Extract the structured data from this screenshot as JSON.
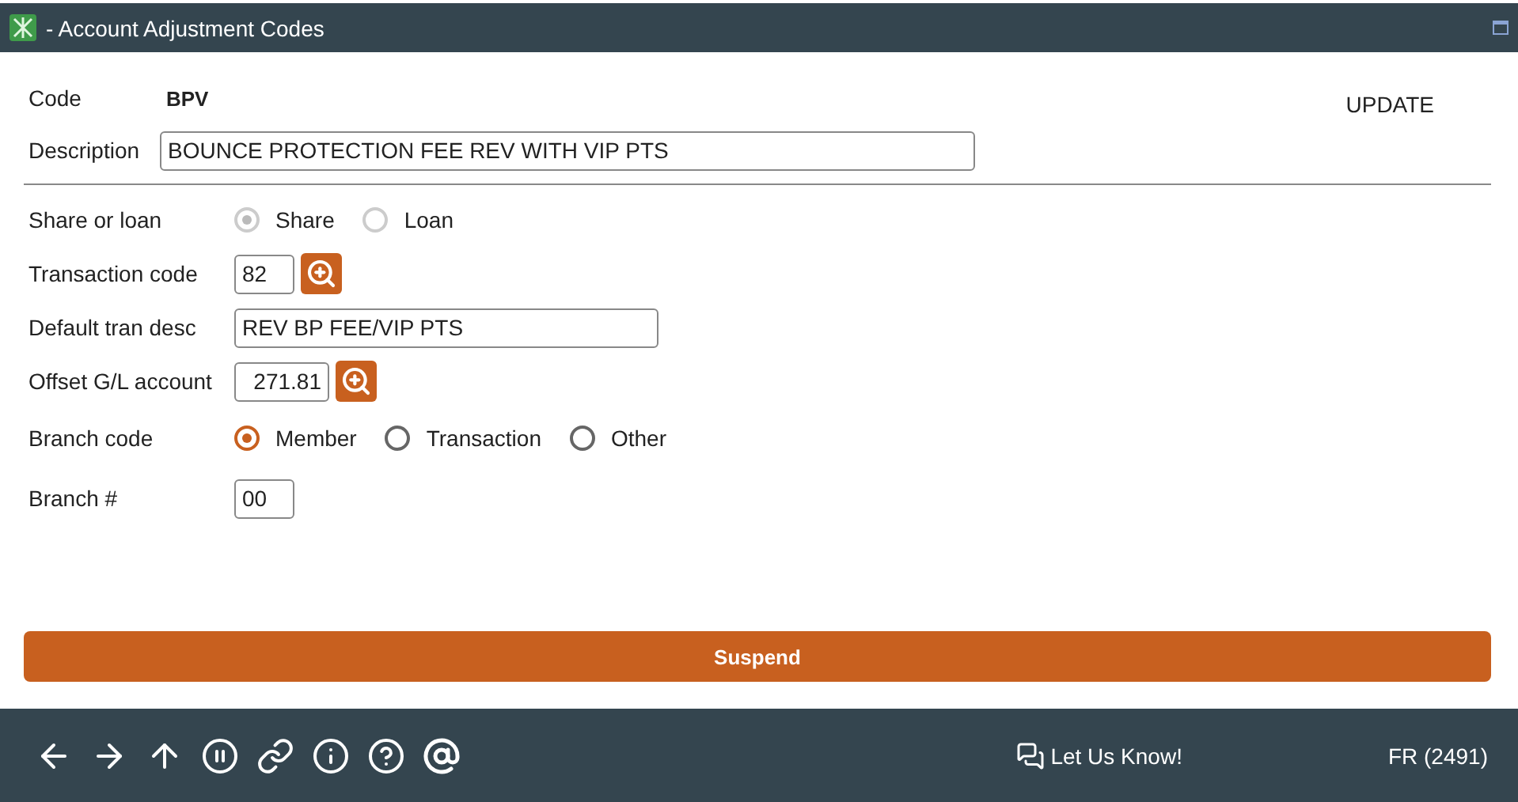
{
  "window": {
    "title": "- Account Adjustment Codes"
  },
  "header": {
    "code_label": "Code",
    "code_value": "BPV",
    "mode": "UPDATE",
    "description_label": "Description",
    "description_value": "BOUNCE PROTECTION FEE REV WITH VIP PTS"
  },
  "fields": [
    {
      "kind": "radio",
      "label": "Share or loan",
      "disabled": true,
      "options": [
        {
          "label": "Share",
          "selected": true
        },
        {
          "label": "Loan",
          "selected": false
        }
      ]
    },
    {
      "kind": "lookup",
      "label": "Transaction code",
      "value": "82"
    },
    {
      "kind": "text",
      "label": "Default tran desc",
      "value": "REV BP FEE/VIP PTS"
    },
    {
      "kind": "lookup",
      "label": "Offset G/L account",
      "value": "271.81"
    },
    {
      "kind": "radio",
      "label": "Branch code",
      "disabled": false,
      "options": [
        {
          "label": "Member",
          "selected": true
        },
        {
          "label": "Transaction",
          "selected": false
        },
        {
          "label": "Other",
          "selected": false
        }
      ]
    },
    {
      "kind": "short",
      "label": "Branch #",
      "value": "00"
    }
  ],
  "suspend_button": "Suspend",
  "footer": {
    "feedback": "Let Us Know!",
    "user": "FR (2491)"
  }
}
